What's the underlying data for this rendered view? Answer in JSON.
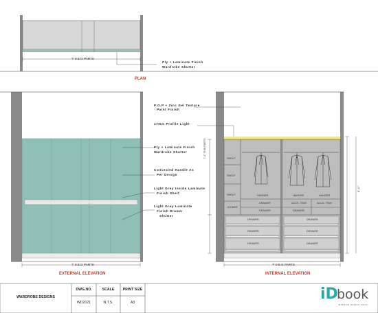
{
  "plan": {
    "title": "PLAN",
    "dim_label": "7'-0 E.G PARTS",
    "shutter_note_1": "Ply + Laminate Finish",
    "shutter_note_2": "Wardrobe Shutter"
  },
  "external": {
    "title": "EXTERNAL ELEVATION",
    "dim_label": "7'-0 E.G PARTS",
    "note_ply_1": "Ply + Laminate Finish",
    "note_ply_2": "Wardrobe Shutter",
    "note_handle_1": "Concealed Handle As",
    "note_handle_2": "Per Design",
    "note_shelf_1": "Light Grey Inside Laminate",
    "note_shelf_2": "Finish Shelf",
    "note_drawer_1": "Light Grey Laminate",
    "note_drawer_2": "Finish Drawer",
    "note_drawer_3": "Shutter",
    "note_pop_1": "P.O.P + Zinc Gel Texture",
    "note_pop_2": "Paint Finish",
    "note_light": "17mm Profile Light"
  },
  "internal": {
    "title": "INTERNAL ELEVATION",
    "dim_label": "7'-0 E.G PARTS",
    "height_label": "8'-11\"",
    "left_height": "7'-3\" THIS PARTS",
    "shelf_1": "SHELF",
    "shelf_2": "SHELF",
    "shelf_3": "SHELF",
    "locker": "LOCKER",
    "hanger_1": "HANGER",
    "hanger_2": "HANGER",
    "hanger_3": "HANGER",
    "drawer_l1": "DRAWER",
    "drawer_l2": "DRAWER",
    "drawer_l3": "DRAWER",
    "drawer_l4": "DRAWER",
    "drawer_l5": "DRAWER",
    "drawer_r1": "DRAWER",
    "drawer_r2": "DRAWER",
    "drawer_r3": "DRAWER",
    "drawer_r4": "DRAWER",
    "accs_tray_1": "ACCS. TRAY",
    "accs_tray_2": "ACCS. TRAY"
  },
  "title_block": {
    "project": "WARDROBE DESIGNS",
    "dwg_no_label": "DWG.NO.",
    "scale_label": "SCALE",
    "print_size_label": "PRINT SIZE",
    "dwg_no": "WD2021",
    "scale": "N.T.S.",
    "print_size": "A3"
  },
  "logo": {
    "brand_id": "iD",
    "brand_word": "book",
    "tagline": "INTERIOR DESIGN IDEAS"
  },
  "colors": {
    "shutter": "#8fbfb5",
    "interior": "#bdbdbd",
    "wall": "#8a8a8a",
    "profile_light": "#f2ef6a",
    "title_red": "#c0392b",
    "logo_teal": "#2aa7a7"
  }
}
